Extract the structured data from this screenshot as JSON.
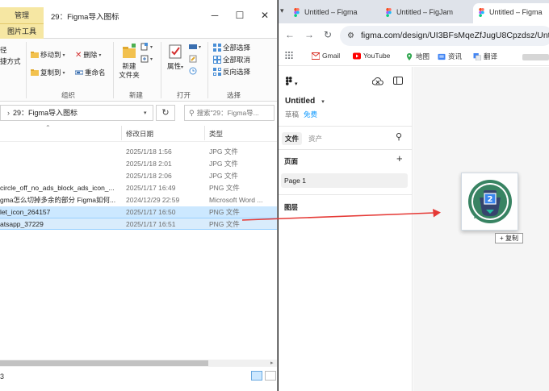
{
  "explorer": {
    "manage_tab": "管理",
    "title": "29：Figma导入图标",
    "ribbon_tab": "图片工具",
    "ribbon": {
      "left_cut_1": "径",
      "left_cut_2": "捷方式",
      "move_to": "移动到",
      "copy_to": "复制到",
      "delete": "删除",
      "rename": "重命名",
      "new_folder_line1": "新建",
      "new_folder_line2": "文件夹",
      "properties": "属性",
      "select_all": "全部选择",
      "select_none": "全部取消",
      "invert_select": "反向选择",
      "group_organize": "组织",
      "group_new": "新建",
      "group_open": "打开",
      "group_select": "选择"
    },
    "address": {
      "path": "29：Figma导入图标"
    },
    "search_placeholder": "搜索\"29：Figma导...",
    "columns": {
      "modified": "修改日期",
      "type": "类型"
    },
    "files": [
      {
        "name": "",
        "date": "2025/1/18 1:56",
        "type": "JPG 文件"
      },
      {
        "name": "",
        "date": "2025/1/18 2:01",
        "type": "JPG 文件"
      },
      {
        "name": "",
        "date": "2025/1/18 2:06",
        "type": "JPG 文件"
      },
      {
        "name": "circle_off_no_ads_block_ads_icon_...",
        "date": "2025/1/17 16:49",
        "type": "PNG 文件"
      },
      {
        "name": "gma怎么切掉多余的部分 Figma如何...",
        "date": "2024/12/29 22:59",
        "type": "Microsoft Word ..."
      },
      {
        "name": "let_icon_264157",
        "date": "2025/1/17 16:50",
        "type": "PNG 文件"
      },
      {
        "name": "atsapp_37229",
        "date": "2025/1/17 16:51",
        "type": "PNG 文件"
      }
    ],
    "status_count": "3"
  },
  "chrome": {
    "tabs": [
      {
        "title": "Untitled – Figma"
      },
      {
        "title": "Untitled – FigJam"
      },
      {
        "title": "Untitled – Figma"
      }
    ],
    "url": "figma.com/design/UI3BFsMqeZfJugU8Cpzdsz/Untitled",
    "bookmarks": [
      "Gmail",
      "YouTube",
      "地图",
      "资讯",
      "翻译"
    ]
  },
  "figma": {
    "file_name": "Untitled",
    "draft_label": "草稿",
    "free_label": "免费",
    "tab_file": "文件",
    "tab_assets": "资产",
    "pages_heading": "页面",
    "page_1": "Page 1",
    "layers_heading": "图层",
    "drag_badge": "+ 复制",
    "ghost_number": "2"
  },
  "colors": {
    "selection": "#cce8ff",
    "figma_blue": "#0d99ff",
    "arrow_red": "#e53935",
    "manage_tab": "#f6e7a3"
  }
}
